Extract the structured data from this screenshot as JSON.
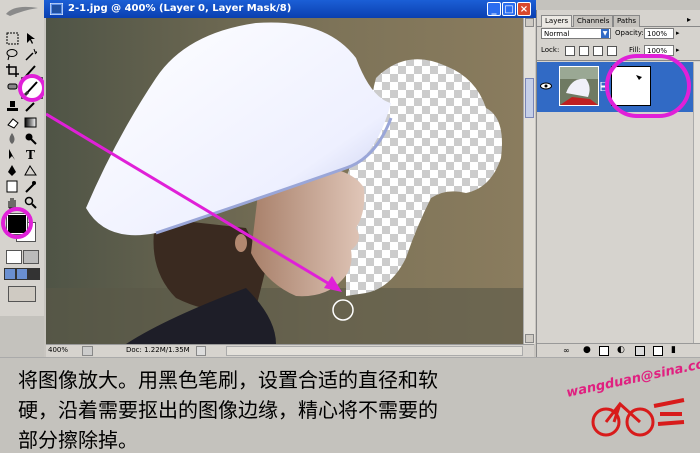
{
  "document": {
    "title": "2-1.jpg @ 400% (Layer 0, Layer Mask/8)",
    "zoom": "400%",
    "doc_size": "Doc: 1.22M/1.35M",
    "window_buttons": [
      "_",
      "□",
      "×"
    ]
  },
  "layers_panel": {
    "tabs": [
      "Layers",
      "Channels",
      "Paths"
    ],
    "active_tab": "Layers",
    "blend_mode": "Normal",
    "opacity_label": "Opacity:",
    "opacity_value": "100%",
    "lock_label": "Lock:",
    "fill_label": "Fill:",
    "fill_value": "100%"
  },
  "toolbox": {
    "foreground_color": "#000000",
    "background_color": "#ffffff"
  },
  "caption": {
    "line1": "将图像放大。用黑色笔刷，设置合适的直径和软",
    "line2": "硬，沿着需要抠出的图像边缘，精心将不需要的",
    "line3": "部分擦除掉。"
  },
  "watermark": "wangduan@sina.com",
  "colors": {
    "highlight": "#e020d8",
    "titlebar": "#0a3fb0",
    "selected_layer": "#316ac5"
  }
}
